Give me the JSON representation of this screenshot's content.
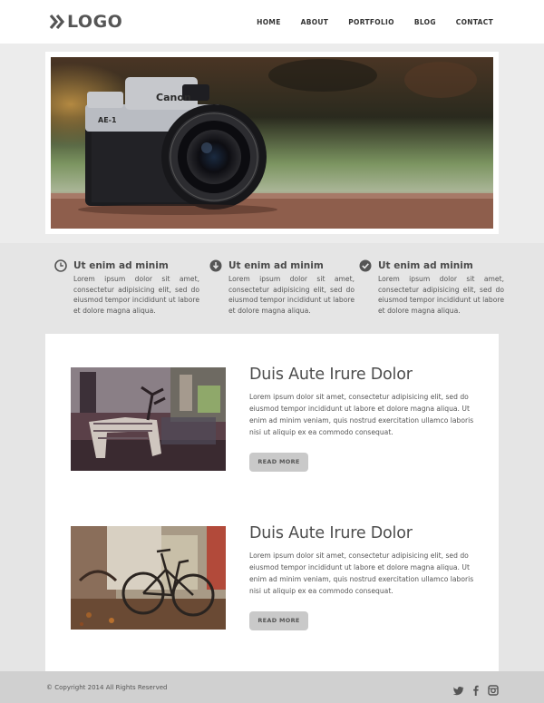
{
  "header": {
    "logo_text": "LOGO",
    "logo_icon": "double-chevron-right-icon",
    "nav": [
      "HOME",
      "ABOUT",
      "PORTFOLIO",
      "BLOG",
      "CONTACT"
    ]
  },
  "hero": {
    "image_subject": "camera-photo",
    "camera_brand": "Canon",
    "camera_model": "AE-1"
  },
  "features": [
    {
      "icon": "clock-icon",
      "title": "Ut enim ad minim",
      "text": "Lorem ipsum dolor sit amet, consectetur adipisicing elit, sed do eiusmod tempor incididunt ut labore et dolore magna aliqua."
    },
    {
      "icon": "download-icon",
      "title": "Ut enim ad minim",
      "text": "Lorem ipsum dolor sit amet, consectetur adipisicing elit, sed do eiusmod tempor incididunt ut labore et dolore magna aliqua."
    },
    {
      "icon": "check-circle-icon",
      "title": "Ut enim ad minim",
      "text": "Lorem ipsum dolor sit amet, consectetur adipisicing elit, sed do eiusmod tempor incididunt ut labore et dolore magna aliqua."
    }
  ],
  "posts": [
    {
      "image": "moose-sculpture-photo",
      "title": "Duis Aute Irure Dolor",
      "text": "Lorem ipsum dolor sit amet, consectetur adipisicing elit, sed do eiusmod tempor incididunt ut labore et dolore magna aliqua. Ut enim ad minim veniam, quis nostrud exercitation ullamco laboris nisi ut aliquip ex ea commodo consequat.",
      "button": "READ MORE"
    },
    {
      "image": "bicycle-photo",
      "title": "Duis Aute Irure Dolor",
      "text": "Lorem ipsum dolor sit amet, consectetur adipisicing elit, sed do eiusmod tempor incididunt ut labore et dolore magna aliqua. Ut enim ad minim veniam, quis nostrud exercitation ullamco laboris nisi ut aliquip ex ea commodo consequat.",
      "button": "READ MORE"
    }
  ],
  "footer": {
    "copyright": "© Copyright 2014 All Rights Reserved",
    "social": [
      "twitter-icon",
      "facebook-icon",
      "instagram-icon"
    ]
  },
  "colors": {
    "header_bg": "#ffffff",
    "band_bg": "#e5e5e5",
    "content_bg": "#ffffff",
    "footer_bg": "#d0d0d0",
    "button_bg": "#c9c9c9",
    "text": "#555555"
  }
}
